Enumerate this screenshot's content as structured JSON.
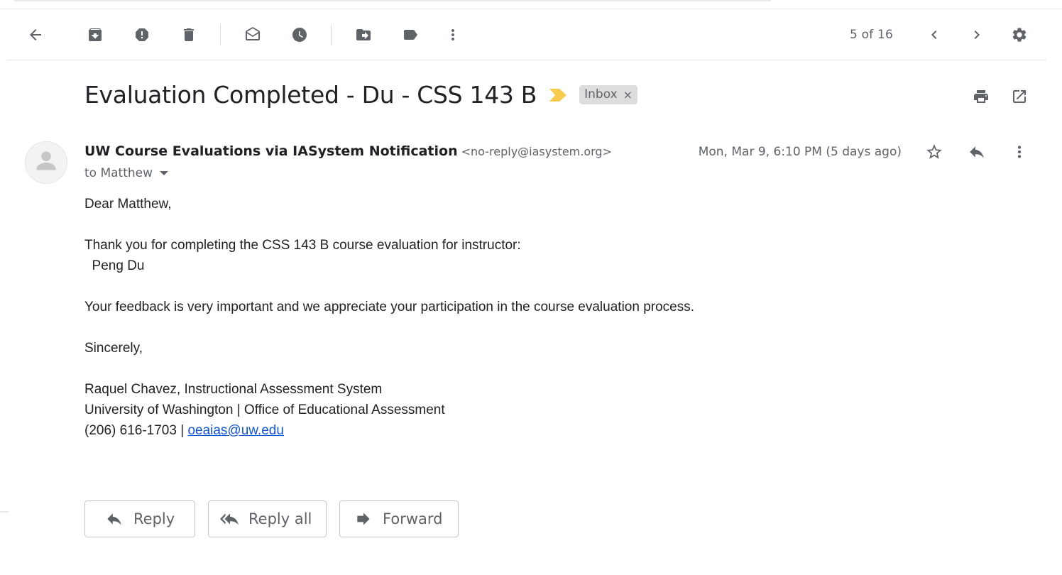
{
  "toolbar": {
    "back": "back-arrow-icon",
    "archive": "archive-icon",
    "spam": "report-spam-icon",
    "delete": "delete-icon",
    "mark_unread": "mark-unread-icon",
    "snooze": "snooze-icon",
    "move_to": "move-to-icon",
    "labels": "label-icon",
    "more": "more-vert-icon",
    "pager_text": "5 of 16",
    "prev": "chevron-left-icon",
    "next": "chevron-right-icon",
    "settings": "settings-gear-icon"
  },
  "email": {
    "subject": "Evaluation Completed - Du - CSS 143 B",
    "label_chip": "Inbox",
    "label_chip_close": "×",
    "sender_name": "UW Course Evaluations via IASystem Notification",
    "sender_email": "<no-reply@iasystem.org>",
    "to_text": "to Matthew",
    "date_text": "Mon, Mar 9, 6:10 PM (5 days ago)",
    "body": {
      "greeting": "Dear Matthew,",
      "line1": "Thank you for completing the CSS 143 B course evaluation for instructor:",
      "instructor": "  Peng Du",
      "line2": "Your feedback is very important and we appreciate your participation in the course evaluation process.",
      "closing": "Sincerely,",
      "sig1": "Raquel Chavez, Instructional Assessment System",
      "sig2": "University of Washington | Office of Educational Assessment",
      "sig3_prefix": "(206) 616-1703 | ",
      "sig3_link": "oeaias@uw.edu"
    }
  },
  "actions": {
    "reply_label": "Reply",
    "reply_all_label": "Reply all",
    "forward_label": "Forward"
  },
  "colors": {
    "icon_gray": "#5f6368",
    "important_marker": "#f7cb4d",
    "chip_bg": "#dddddd",
    "link": "#1155cc"
  }
}
